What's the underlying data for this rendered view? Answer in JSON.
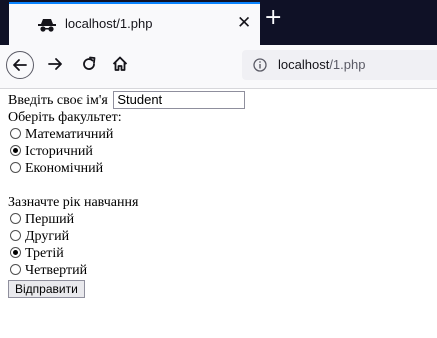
{
  "browser": {
    "tab_title": "localhost/1.php",
    "close_glyph": "✕",
    "new_tab_glyph": "+",
    "url_host": "localhost",
    "url_path": "/1.php"
  },
  "form": {
    "name_label": "Введіть своє ім'я",
    "name_value": "Student",
    "faculty_label": "Оберіть факультет:",
    "faculties": [
      {
        "label": "Математичний",
        "checked": false
      },
      {
        "label": "Історичний",
        "checked": true
      },
      {
        "label": "Економічний",
        "checked": false
      }
    ],
    "year_label": "Зазначте рік навчання",
    "years": [
      {
        "label": "Перший",
        "checked": false
      },
      {
        "label": "Другий",
        "checked": false
      },
      {
        "label": "Третій",
        "checked": true
      },
      {
        "label": "Четвертий",
        "checked": false
      }
    ],
    "submit_label": "Відправити"
  },
  "icons": {
    "tab": "private-browsing-icon",
    "back": "back-arrow-icon",
    "forward": "forward-arrow-icon",
    "reload": "reload-icon",
    "home": "home-icon",
    "info": "info-icon"
  },
  "colors": {
    "tabbar_bg": "#0f1126",
    "accent": "#0a84ff",
    "toolbar_bg": "#f9f9fb"
  }
}
